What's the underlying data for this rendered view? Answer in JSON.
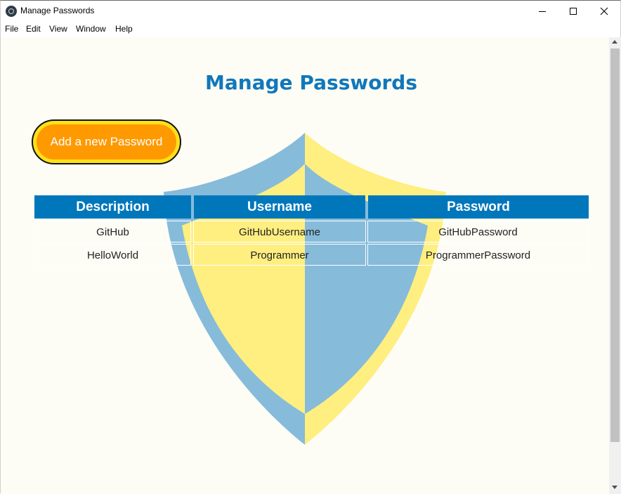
{
  "window": {
    "title": "Manage Passwords",
    "controls": {
      "minimize": "minimize-icon",
      "maximize": "maximize-icon",
      "close": "close-icon"
    }
  },
  "menu": {
    "items": [
      "File",
      "Edit",
      "View",
      "Window",
      "Help"
    ]
  },
  "page": {
    "title": "Manage Passwords",
    "add_button_label": "Add a new Password"
  },
  "table": {
    "columns": [
      "Description",
      "Username",
      "Password"
    ],
    "rows": [
      [
        "GitHub",
        "GitHubUsername",
        "GitHubPassword"
      ],
      [
        "HelloWorld",
        "Programmer",
        "ProgrammerPassword"
      ]
    ]
  },
  "colors": {
    "accent": "#0077bb",
    "title": "#1177bb",
    "button_fill": "#ff9900",
    "button_ring": "#ffe019",
    "shield_blue": "#86bbda",
    "shield_yellow": "#ffee80",
    "background": "#fdfdf6"
  }
}
